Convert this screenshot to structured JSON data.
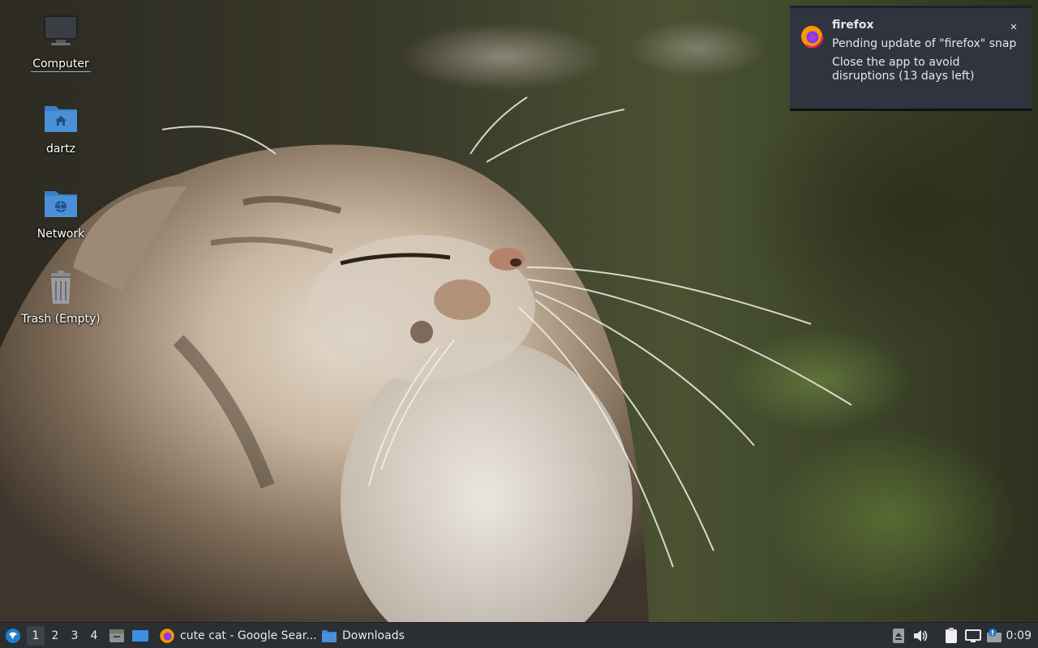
{
  "desktop": {
    "icons": [
      {
        "label": "Computer",
        "icon": "computer-icon",
        "selected": true
      },
      {
        "label": "dartz",
        "icon": "home-folder-icon"
      },
      {
        "label": "Network",
        "icon": "network-folder-icon"
      },
      {
        "label": "Trash (Empty)",
        "icon": "trash-icon"
      }
    ]
  },
  "notification": {
    "app": "firefox",
    "icon": "firefox-icon",
    "summary": "Pending update of \"firefox\" snap",
    "detail": "Close the app to avoid disruptions (13 days left)",
    "close_icon": "close-icon"
  },
  "taskbar": {
    "start_icon": "start-menu-icon",
    "workspaces": [
      "1",
      "2",
      "3",
      "4"
    ],
    "active_workspace": "1",
    "launchers": [
      "file-manager-icon",
      "show-desktop-icon"
    ],
    "tasks": [
      {
        "label": "cute cat - Google Sear...",
        "icon": "firefox-icon"
      },
      {
        "label": "Downloads",
        "icon": "folder-icon"
      }
    ],
    "tray": [
      "eject-icon",
      "volume-icon",
      "clipboard-icon",
      "network-icon",
      "update-notifier-icon"
    ],
    "clock": "0:09"
  },
  "colors": {
    "panel": "#2b2e33",
    "notification_bg": "#2f343f",
    "folder_blue": "#4a90d9"
  }
}
